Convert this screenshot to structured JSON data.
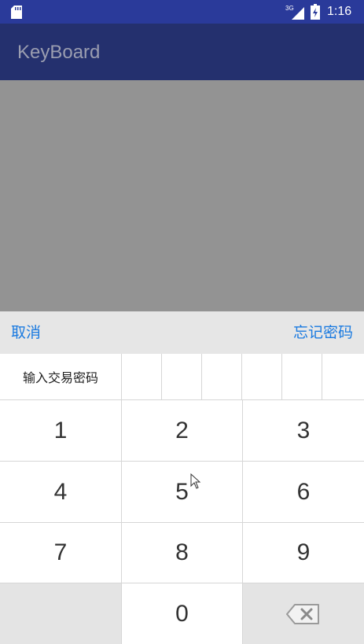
{
  "status_bar": {
    "network": "3G",
    "time": "1:16",
    "icons": [
      "sd-card-icon",
      "signal-icon",
      "battery-icon"
    ]
  },
  "app_bar": {
    "title": "KeyBoard"
  },
  "dialog": {
    "cancel_label": "取消",
    "forgot_label": "忘记密码",
    "password_label": "输入交易密码",
    "password_length": 6
  },
  "keypad": {
    "keys": [
      "1",
      "2",
      "3",
      "4",
      "5",
      "6",
      "7",
      "8",
      "9",
      "",
      "0",
      "delete"
    ]
  },
  "colors": {
    "status_bar": "#2a3a9a",
    "app_bar": "#24306e",
    "link": "#1a7ae0",
    "overlay": "#939393",
    "action_bar": "#e6e6e6",
    "key_dark": "#e4e4e4"
  }
}
